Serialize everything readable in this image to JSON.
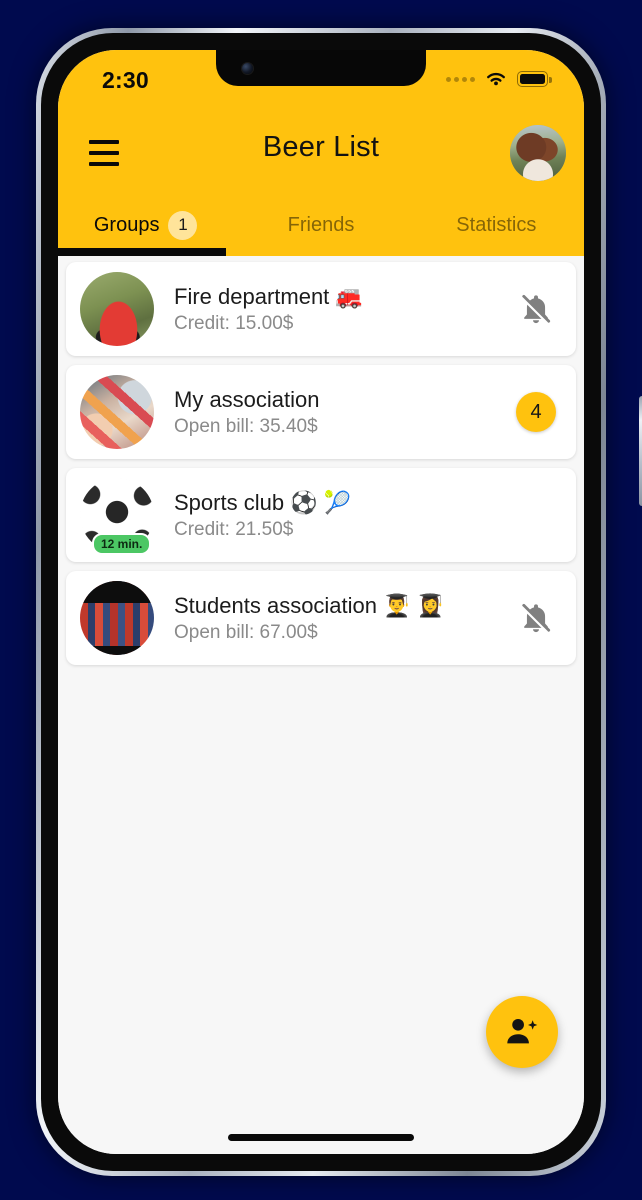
{
  "status_bar": {
    "time": "2:30",
    "signal_icon": "signal-dots-icon",
    "wifi_icon": "wifi-icon",
    "battery_icon": "battery-full-icon"
  },
  "app_bar": {
    "menu_icon": "hamburger-menu-icon",
    "title": "Beer List",
    "avatar_icon": "profile-avatar"
  },
  "tabs": [
    {
      "label": "Groups",
      "badge": "1",
      "active": true
    },
    {
      "label": "Friends",
      "badge": "",
      "active": false
    },
    {
      "label": "Statistics",
      "badge": "",
      "active": false
    }
  ],
  "groups": [
    {
      "title": "Fire department 🚒",
      "subtitle": "Credit: 15.00$",
      "avatar": "fire-truck-photo",
      "time_badge": "",
      "right_icon": "bell-off-icon",
      "right_badge": ""
    },
    {
      "title": "My association",
      "subtitle": "Open bill: 35.40$",
      "avatar": "drinks-cheers-photo",
      "time_badge": "",
      "right_icon": "",
      "right_badge": "4"
    },
    {
      "title": "Sports club ⚽ 🎾",
      "subtitle": "Credit: 21.50$",
      "avatar": "soccer-ball-photo",
      "time_badge": "12 min.",
      "right_icon": "",
      "right_badge": ""
    },
    {
      "title": "Students association 👨‍🎓 👩‍🎓",
      "subtitle": "Open bill: 67.00$",
      "avatar": "books-photo",
      "time_badge": "",
      "right_icon": "bell-off-icon",
      "right_badge": ""
    }
  ],
  "fab": {
    "icon": "person-add-icon",
    "label": ""
  },
  "colors": {
    "brand_yellow": "#ffc20e",
    "tab_badge": "#ffe49a",
    "page_background": "#f7f7f7",
    "card_background": "#ffffff",
    "title_text": "#1c1c1c",
    "subtitle_text": "#8a8a8a",
    "time_badge_green": "#4cc764",
    "scene_background": "#000a4e"
  }
}
